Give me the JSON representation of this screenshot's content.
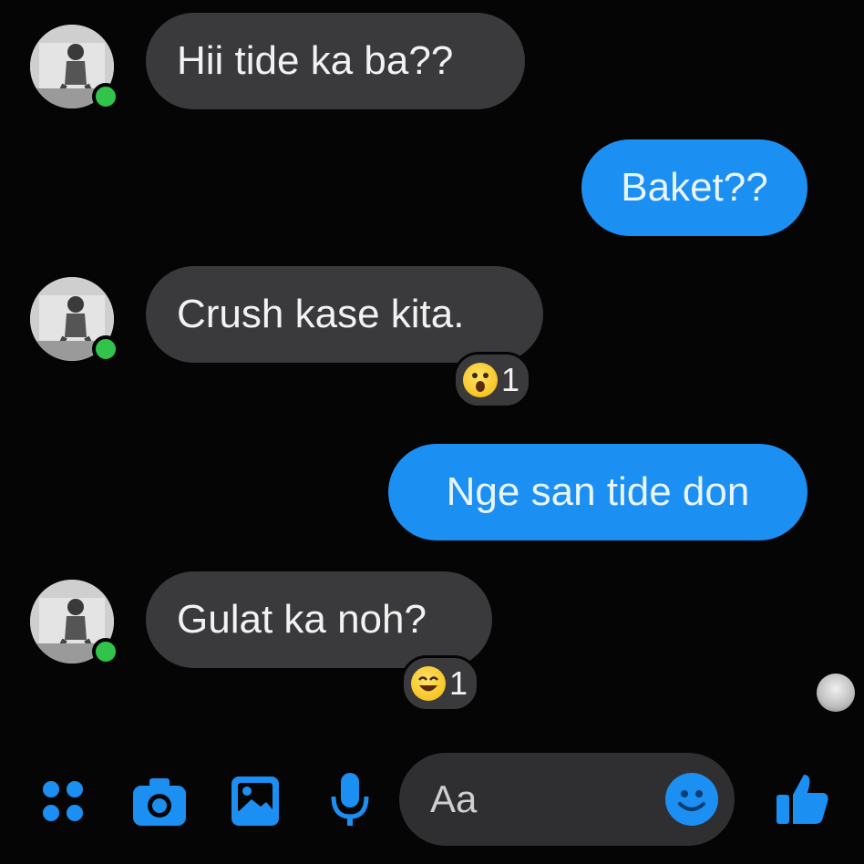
{
  "messages": [
    {
      "direction": "incoming",
      "text": "Hii tide ka ba??"
    },
    {
      "direction": "outgoing",
      "text": "Baket??"
    },
    {
      "direction": "incoming",
      "text": "Crush kase kita.",
      "reaction": {
        "emoji": "surprised-face",
        "count": "1"
      }
    },
    {
      "direction": "outgoing",
      "text": "Nge san tide don"
    },
    {
      "direction": "incoming",
      "text": "Gulat ka noh?",
      "reaction": {
        "emoji": "laughing-face",
        "count": "1"
      }
    }
  ],
  "composer": {
    "placeholder": "Aa",
    "icons": [
      "menu-dots-icon",
      "camera-icon",
      "gallery-icon",
      "microphone-icon",
      "emoji-icon",
      "thumbs-up-icon"
    ]
  },
  "colors": {
    "background": "#050505",
    "incoming_bubble": "#3a3a3c",
    "outgoing_bubble": "#1c8ff3",
    "accent": "#1c8ff3",
    "online": "#31c34a"
  }
}
